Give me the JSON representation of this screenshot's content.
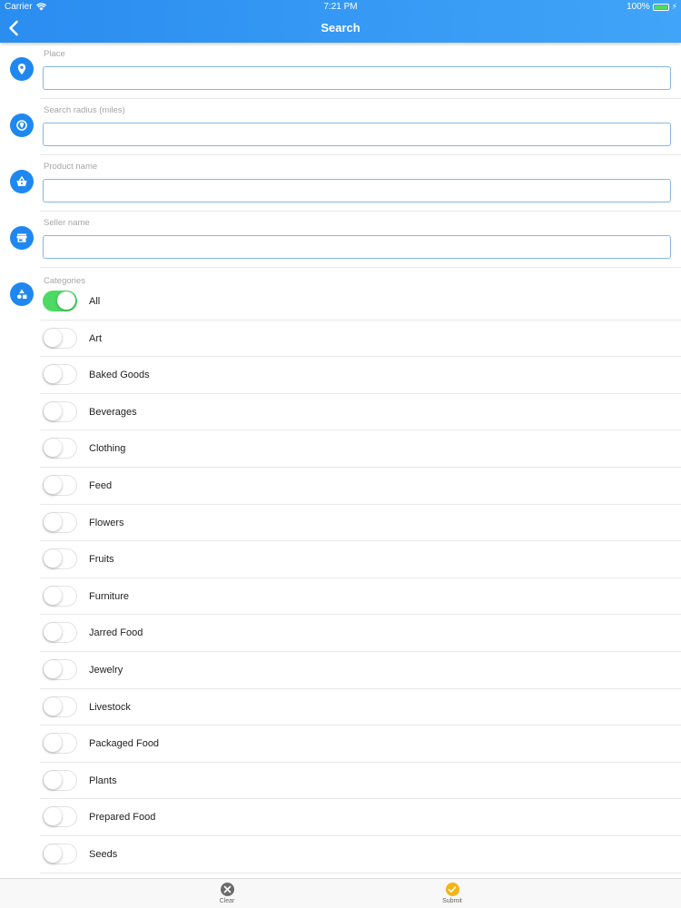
{
  "status_bar": {
    "carrier": "Carrier",
    "time": "7:21 PM",
    "battery": "100%"
  },
  "nav": {
    "title": "Search"
  },
  "fields": [
    {
      "label": "Place",
      "value": "",
      "icon": "map-marker-icon"
    },
    {
      "label": "Search radius (miles)",
      "value": "",
      "icon": "radius-icon"
    },
    {
      "label": "Product name",
      "value": "",
      "icon": "basket-icon"
    },
    {
      "label": "Seller name",
      "value": "",
      "icon": "storefront-icon"
    }
  ],
  "categories": {
    "label": "Categories",
    "icon": "shapes-icon",
    "items": [
      {
        "name": "All",
        "on": true
      },
      {
        "name": "Art",
        "on": false
      },
      {
        "name": "Baked Goods",
        "on": false
      },
      {
        "name": "Beverages",
        "on": false
      },
      {
        "name": "Clothing",
        "on": false
      },
      {
        "name": "Feed",
        "on": false
      },
      {
        "name": "Flowers",
        "on": false
      },
      {
        "name": "Fruits",
        "on": false
      },
      {
        "name": "Furniture",
        "on": false
      },
      {
        "name": "Jarred Food",
        "on": false
      },
      {
        "name": "Jewelry",
        "on": false
      },
      {
        "name": "Livestock",
        "on": false
      },
      {
        "name": "Packaged Food",
        "on": false
      },
      {
        "name": "Plants",
        "on": false
      },
      {
        "name": "Prepared Food",
        "on": false
      },
      {
        "name": "Seeds",
        "on": false
      }
    ]
  },
  "tabbar": {
    "clear_label": "Clear",
    "submit_label": "Submit"
  },
  "colors": {
    "accent": "#1e88f0",
    "toggle_on": "#4cd964",
    "clear_icon": "#6b6b6b",
    "submit_icon": "#f5b316"
  }
}
